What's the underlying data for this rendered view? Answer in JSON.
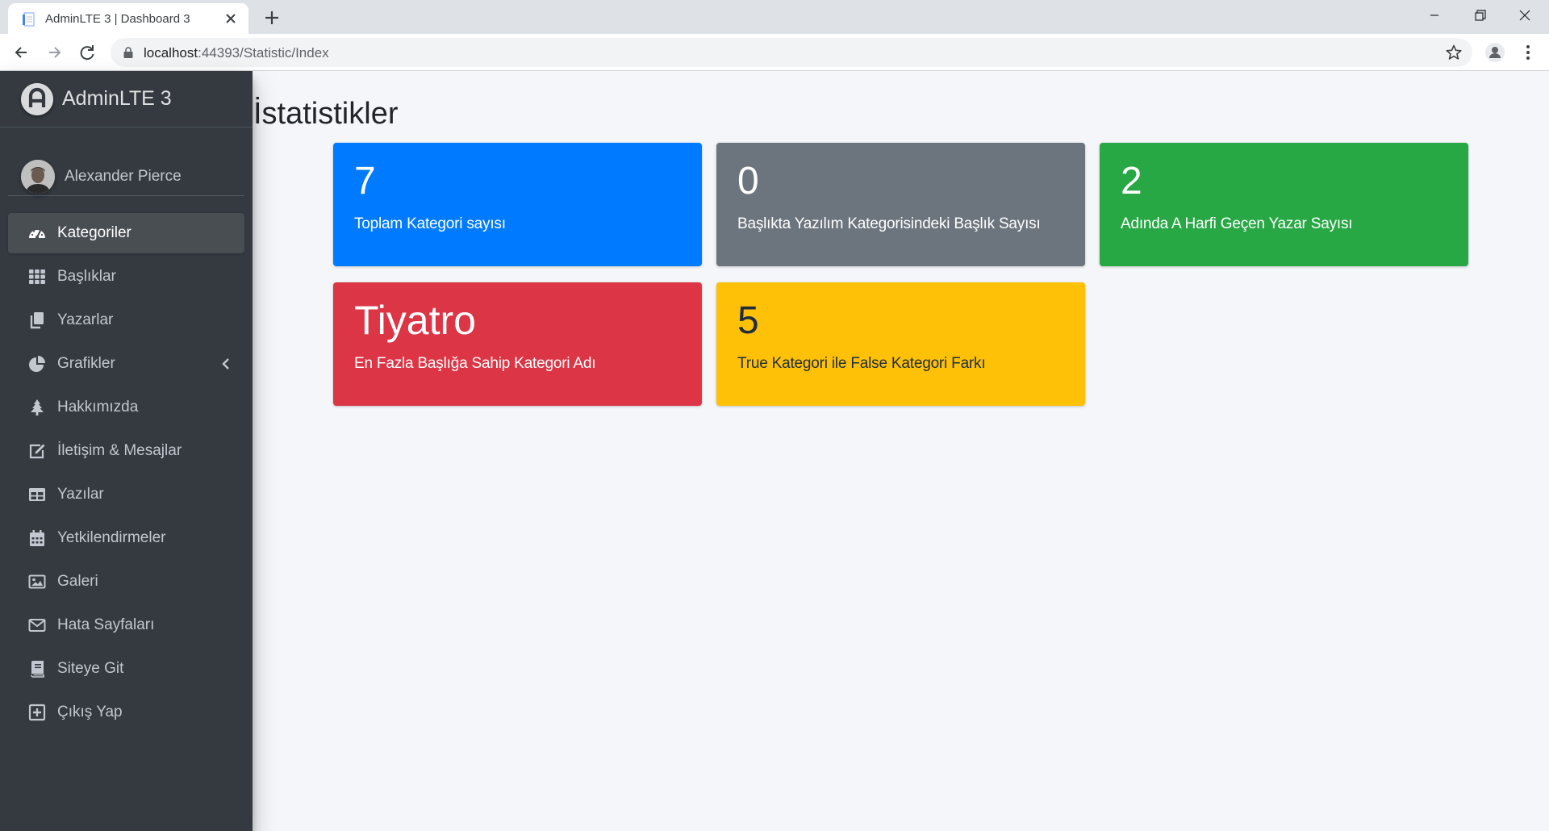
{
  "browser": {
    "tab_title": "AdminLTE 3 | Dashboard 3",
    "url_host": "localhost",
    "url_path": ":44393/Statistic/Index"
  },
  "sidebar": {
    "brand": "AdminLTE 3",
    "user_name": "Alexander Pierce",
    "items": [
      {
        "label": "Kategoriler",
        "icon": "tachometer-icon",
        "active": true
      },
      {
        "label": "Başlıklar",
        "icon": "th-grid-icon"
      },
      {
        "label": "Yazarlar",
        "icon": "copy-icon"
      },
      {
        "label": "Grafikler",
        "icon": "chart-pie-icon",
        "has_arrow": true
      },
      {
        "label": "Hakkımızda",
        "icon": "tree-icon"
      },
      {
        "label": "İletişim & Mesajlar",
        "icon": "edit-icon"
      },
      {
        "label": "Yazılar",
        "icon": "table-icon"
      },
      {
        "label": "Yetkilendirmeler",
        "icon": "calendar-icon"
      },
      {
        "label": "Galeri",
        "icon": "image-icon"
      },
      {
        "label": "Hata Sayfaları",
        "icon": "envelope-icon"
      },
      {
        "label": "Siteye Git",
        "icon": "book-icon"
      },
      {
        "label": "Çıkış Yap",
        "icon": "plus-square-icon"
      }
    ]
  },
  "page": {
    "title": "İstatistikler"
  },
  "stats": [
    {
      "value": "7",
      "label": "Toplam Kategori sayısı",
      "color": "#007bff"
    },
    {
      "value": "0",
      "label": "Başlıkta Yazılım Kategorisindeki Başlık Sayısı",
      "color": "#6c757d"
    },
    {
      "value": "2",
      "label": "Adında A Harfi Geçen Yazar Sayısı",
      "color": "#28a745"
    },
    {
      "value": "Tiyatro",
      "label": "En Fazla Başlığa Sahip Kategori Adı",
      "color": "#dc3545"
    },
    {
      "value": "5",
      "label": "True Kategori ile False Kategori Farkı",
      "color": "#ffc107"
    }
  ]
}
